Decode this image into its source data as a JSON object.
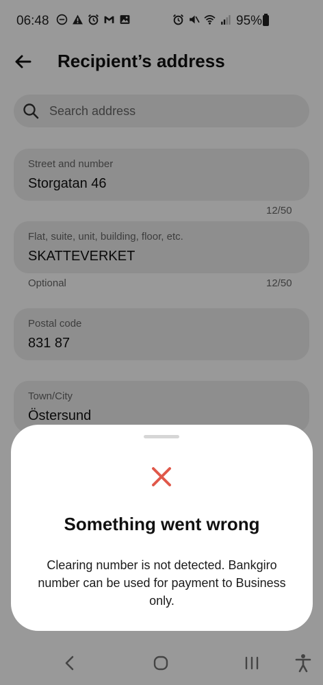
{
  "status_bar": {
    "time": "06:48",
    "battery_percent": "95%",
    "left_icons": [
      "do-not-disturb-icon",
      "warning-icon",
      "alarm-icon",
      "gmail-icon",
      "image-icon"
    ],
    "right_icons": [
      "alarm-icon",
      "mute-icon",
      "wifi-icon",
      "signal-icon",
      "battery-icon"
    ]
  },
  "header": {
    "title": "Recipient’s address",
    "back_icon": "arrow-left-icon"
  },
  "search": {
    "placeholder": "Search address",
    "value": ""
  },
  "form": {
    "street": {
      "label": "Street and number",
      "value": "Storgatan 46",
      "counter": "12/50"
    },
    "flat": {
      "label": "Flat, suite, unit, building, floor, etc.",
      "value": "SKATTEVERKET",
      "helper": "Optional",
      "counter": "12/50"
    },
    "postal": {
      "label": "Postal code",
      "value": "831 87"
    },
    "town": {
      "label": "Town/City",
      "value": "Östersund"
    }
  },
  "error_sheet": {
    "title": "Something went wrong",
    "message": "Clearing number is not detected. Bankgiro number can be used for payment to Business only.",
    "icon": "close-icon",
    "icon_color": "#e0584a"
  },
  "nav_bar": {
    "buttons": [
      "back-nav-icon",
      "home-nav-icon",
      "recents-nav-icon",
      "accessibility-icon"
    ]
  }
}
